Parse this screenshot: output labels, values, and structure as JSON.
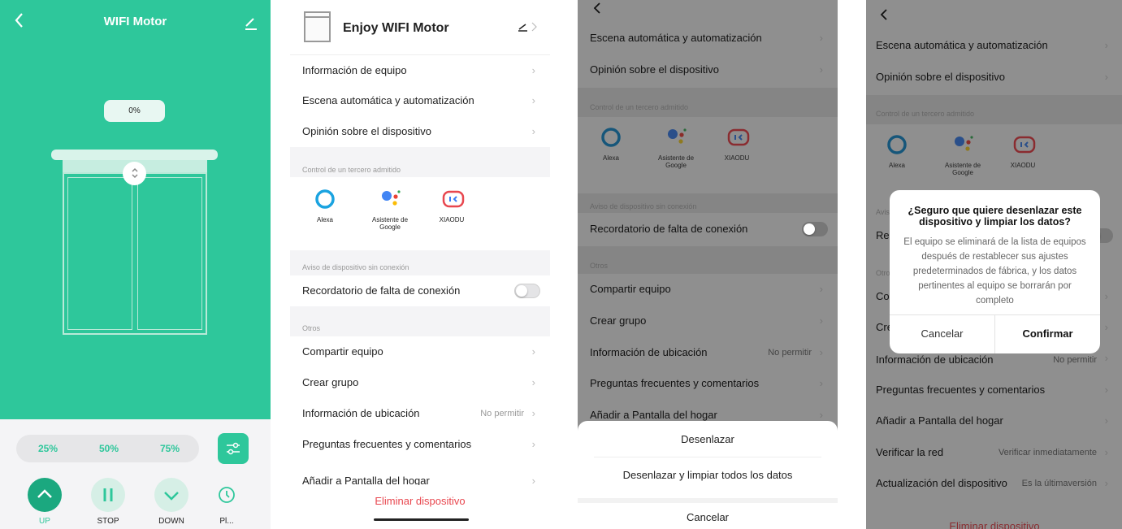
{
  "panel1": {
    "title": "WIFI Motor",
    "percent": "0%",
    "presets": [
      "25%",
      "50%",
      "75%"
    ],
    "controls": {
      "up": "UP",
      "stop": "STOP",
      "down": "DOWN",
      "plan": "Pl..."
    },
    "accent": "#2ec79b"
  },
  "panel2": {
    "title": "Enjoy WIFI Motor",
    "info": "Información de equipo",
    "scene": "Escena automática y automatización",
    "feedback": "Opinión sobre el dispositivo",
    "third_party_label": "Control de un tercero admitido",
    "third_party": [
      "Alexa",
      "Asistente de Google",
      "XIAODU"
    ],
    "offline_label": "Aviso de dispositivo sin conexión",
    "offline_reminder": "Recordatorio de falta de conexión",
    "others_label": "Otros",
    "share": "Compartir equipo",
    "group": "Crear grupo",
    "location": "Información de ubicación",
    "location_value": "No permitir",
    "faq": "Preguntas frecuentes y comentarios",
    "home_screen": "Añadir a Pantalla del hogar",
    "remove": "Eliminar dispositivo"
  },
  "panel3": {
    "scene": "Escena automática y automatización",
    "feedback": "Opinión sobre el dispositivo",
    "third_party_label": "Control de un tercero admitido",
    "third_party": [
      "Alexa",
      "Asistente de Google",
      "XIAODU"
    ],
    "offline_label": "Aviso de dispositivo sin conexión",
    "offline_reminder": "Recordatorio de falta de conexión",
    "others_label": "Otros",
    "share": "Compartir equipo",
    "group": "Crear grupo",
    "location": "Información de ubicación",
    "location_value": "No permitir",
    "faq": "Preguntas frecuentes y comentarios",
    "home_screen": "Añadir a Pantalla del hogar",
    "sheet": {
      "unlink": "Desenlazar",
      "unlink_wipe": "Desenlazar y limpiar todos los datos",
      "cancel": "Cancelar"
    }
  },
  "panel4": {
    "scene": "Escena automática y automatización",
    "feedback": "Opinión sobre el dispositivo",
    "third_party_label": "Control de un tercero admitido",
    "third_party": [
      "Alexa",
      "Asistente de Google",
      "XIAODU"
    ],
    "offline_label_partial": "Avis",
    "offline_reminder_partial": "Rec",
    "others_label_partial": "Otro",
    "share_partial": "Co",
    "group_partial": "Cre",
    "location": "Información de ubicación",
    "location_value": "No permitir",
    "faq": "Preguntas frecuentes y comentarios",
    "home_screen": "Añadir a Pantalla del hogar",
    "verify_network": "Verificar la red",
    "verify_value": "Verificar inmediatamente",
    "update": "Actualización del dispositivo",
    "update_value": "Es la últimaversión",
    "remove": "Eliminar dispositivo",
    "dialog": {
      "title": "¿Seguro que quiere desenlazar este dispositivo y limpiar los datos?",
      "body": "El equipo se eliminará de la lista de equipos después de restablecer sus ajustes predeterminados de fábrica, y los datos pertinentes al equipo se borrarán por completo",
      "cancel": "Cancelar",
      "confirm": "Confirmar"
    }
  }
}
